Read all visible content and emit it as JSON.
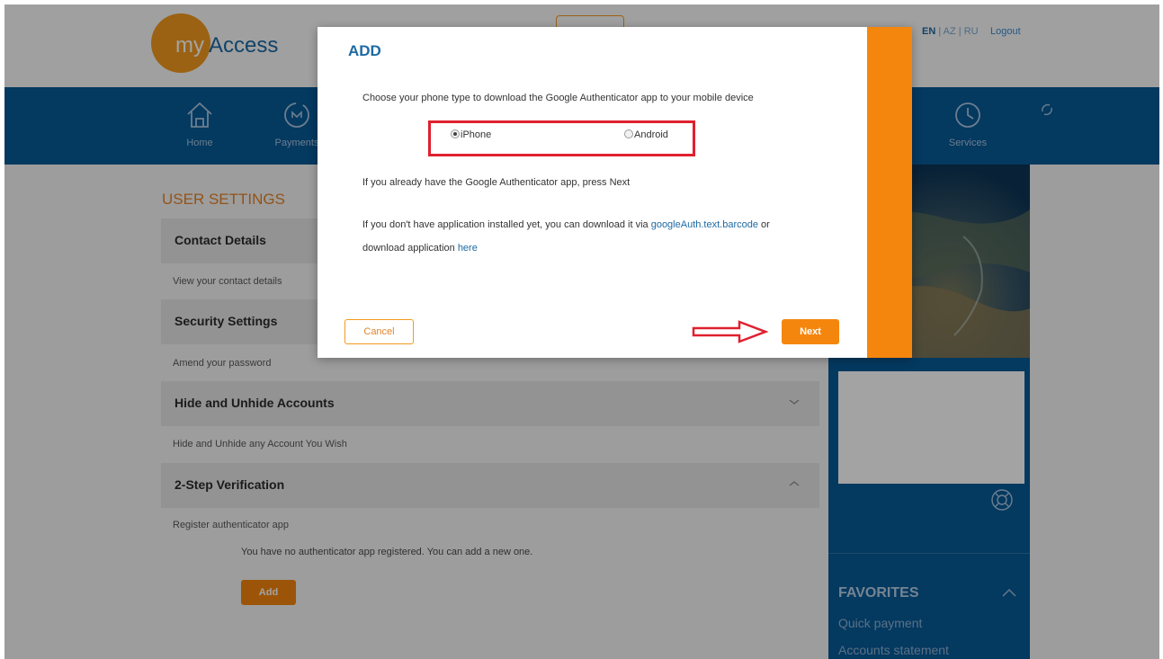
{
  "header": {
    "logo_my": "my",
    "logo_access": "Access",
    "languages": [
      "EN",
      "AZ",
      "RU"
    ],
    "lang_separator": "|",
    "logout": "Logout"
  },
  "nav": {
    "items": [
      {
        "label": "Home",
        "icon": "home-icon"
      },
      {
        "label": "Payments",
        "icon": "payments-icon"
      },
      {
        "label": "Services",
        "icon": "services-icon"
      }
    ]
  },
  "settings": {
    "title": "USER SETTINGS",
    "sections": [
      {
        "heading": "Contact Details",
        "sub": "View your contact details"
      },
      {
        "heading": "Security Settings",
        "sub": "Amend your password"
      },
      {
        "heading": "Hide and Unhide Accounts",
        "sub": "Hide and Unhide any Account You Wish"
      },
      {
        "heading": "2-Step Verification",
        "sub": "Register authenticator app"
      }
    ],
    "no_app_text": "You have no authenticator app registered. You can add a new one.",
    "add_button": "Add"
  },
  "right": {
    "favorites_title": "FAVORITES",
    "favorites": [
      "Quick payment",
      "Accounts statement"
    ]
  },
  "modal": {
    "title": "ADD",
    "choose_text": "Choose your phone type to download the Google Authenticator app to your mobile device",
    "options": [
      "iPhone",
      "Android"
    ],
    "selected_option": "iPhone",
    "already_text": "If you already have the Google Authenticator app, press Next",
    "download_text_1": "If you don't have application installed yet, you can download it via",
    "download_link": "googleAuth.text.barcode",
    "download_text_2": "or",
    "download_text_3": "download application",
    "here_link": "here",
    "cancel_button": "Cancel",
    "next_button": "Next"
  },
  "colors": {
    "accent_orange": "#f5860d",
    "brand_blue": "#075a96",
    "highlight_red": "#e0202f"
  }
}
